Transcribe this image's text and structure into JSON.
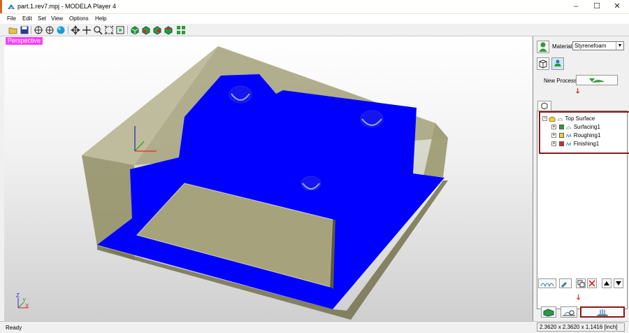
{
  "window": {
    "title": "part.1.rev7.mpj - MODELA Player 4",
    "minimize": "–",
    "maximize": "☐",
    "close": "✕"
  },
  "menu": [
    "File",
    "Edit",
    "Set",
    "View",
    "Options",
    "Help"
  ],
  "toolbar": {
    "icons": [
      "open-icon",
      "save-icon",
      "view-center-icon",
      "view-rotate-icon",
      "view-sphere-icon",
      "pan-icon",
      "move-icon",
      "zoom-icon",
      "fit-icon",
      "zoom-window-icon",
      "view-iso-icon",
      "view-front-icon",
      "view-side-icon",
      "view-top-icon",
      "grid-view-icon"
    ]
  },
  "viewport": {
    "view_label": "Perspective",
    "axis_z": "Z",
    "axis_y": "Y",
    "axis_x": "X"
  },
  "panel": {
    "material_label": "Material",
    "material_value": "Styrenefoam",
    "new_process_label": "New Process",
    "tree": {
      "root": "Top Surface",
      "items": [
        "Surfacing1",
        "Roughing1",
        "Finishing1"
      ]
    }
  },
  "status": {
    "left": "Ready",
    "right": "2.3620 x 2.3620 x 1.1416 [inch]"
  },
  "colors": {
    "model_blue": "#0000ff",
    "stock_khaki": "#8c8c5a",
    "highlight_red": "#8b1a1a",
    "label_magenta": "#ff3cff"
  }
}
